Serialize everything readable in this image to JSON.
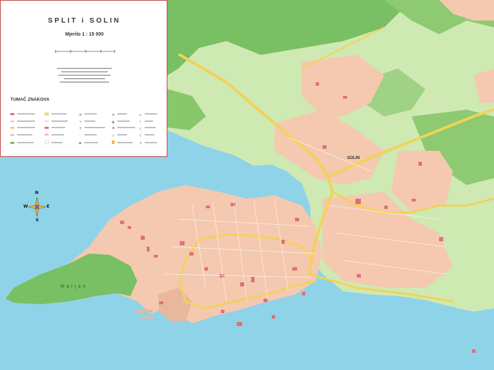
{
  "map": {
    "title": "SPLIT i SOLIN",
    "scale": "Mjerilo 1 : 15 000",
    "legend_heading": "TUMAČ ZNAKOVA",
    "place_labels": [
      "SOLIN",
      "Marjan"
    ],
    "compass": {
      "north": "N",
      "south": "S",
      "east": "E",
      "west": "W"
    },
    "colors": {
      "sea": "#8fd3e8",
      "land": "#cfe9b3",
      "forest": "#79bf63",
      "built_up": "#f4c9b0",
      "building": "#e0707a",
      "major_road": "#f2d25a",
      "legend_border": "#c04848"
    }
  }
}
